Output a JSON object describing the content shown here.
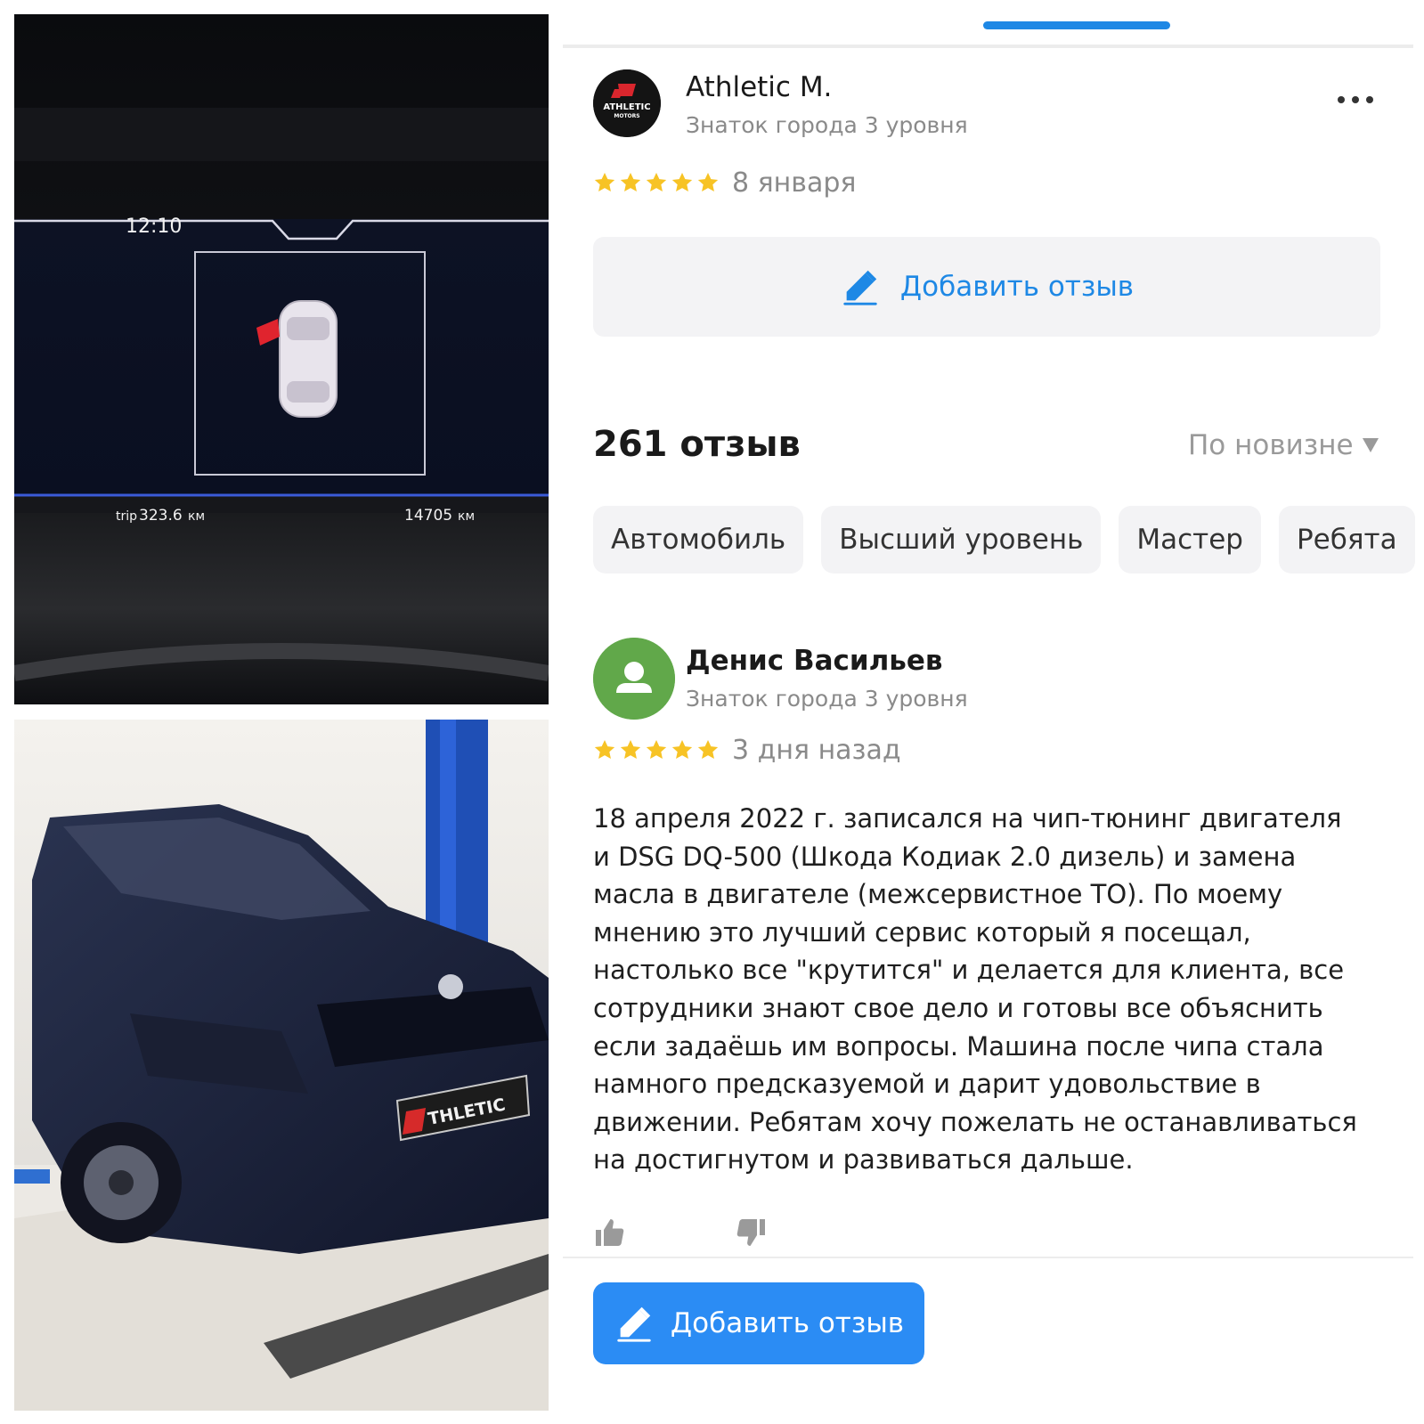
{
  "dashboard_photo": {
    "clock": "12:10",
    "trip_label": "trip",
    "trip_value": "323.6",
    "trip_unit": "км",
    "odometer_value": "14705",
    "odometer_unit": "км"
  },
  "car_photo": {
    "plate_brand": "THLETIC"
  },
  "org": {
    "logo_text_top": "ATHLETIC",
    "logo_text_bottom": "MOTORS",
    "name": "Athletic M.",
    "level": "Знаток города 3 уровня",
    "rating_stars": 5,
    "date": "8 января",
    "more_icon": "more-horizontal-icon"
  },
  "add_review_top": {
    "label": "Добавить отзыв",
    "icon": "pencil-icon"
  },
  "reviews_header": {
    "count_label": "261 отзыв",
    "sort_label": "По новизне",
    "sort_icon": "triangle-down-icon"
  },
  "chips": [
    "Автомобиль",
    "Высший уровень",
    "Мастер",
    "Ребята"
  ],
  "review": {
    "author": "Денис Васильев",
    "level": "Знаток города 3 уровня",
    "rating_stars": 5,
    "date": "3 дня назад",
    "text": "18 апреля 2022 г. записался на чип-тюнинг двигателя\nи DSG DQ-500 (Шкода Кодиак 2.0 дизель) и замена\nмасла в двигателе (межсервистное ТО).  По моему\nмнению это лучший сервис который я посещал,\nнастолько все  \"крутится\" и делается для клиента, все\nсотрудники знают свое дело и готовы все объяснить\nесли задаёшь им вопросы.  Машина после чипа стала\nнамного предсказуемой и дарит удовольствие в\nдвижении.  Ребятам хочу пожелать не останавливаться\nна достигнутом и развиваться дальше."
  },
  "add_review_bottom": {
    "label": "Добавить отзыв",
    "icon": "pencil-icon"
  },
  "colors": {
    "accent": "#1e88e5",
    "button_blue": "#2b8cf4",
    "star": "#f7c325",
    "avatar_green": "#61a84a",
    "muted_text": "#8a8a8a",
    "chip_bg": "#f3f3f5"
  }
}
